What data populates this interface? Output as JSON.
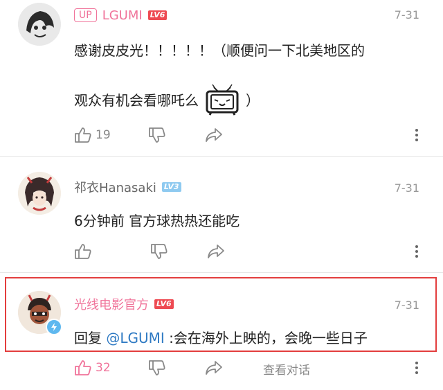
{
  "comments": [
    {
      "up_badge": "UP",
      "username": "LGUMI",
      "level": "LV6",
      "date": "7-31",
      "text_line1": "感谢皮皮光！！！！！（顺便问一下北美地区的",
      "text_line2_before": "观众有机会看哪吒么",
      "text_line2_after": "）",
      "emote_icon": "bilibili-tv-emote-icon",
      "likes": "19"
    },
    {
      "username": "祁衣Hanasaki",
      "level": "LV3",
      "date": "7-31",
      "text": "6分钟前 官方球热热还能吃"
    },
    {
      "username": "光线电影官方",
      "level": "LV6",
      "date": "7-31",
      "text_prefix": "回复 ",
      "mention": "@LGUMI",
      "text_suffix": " :会在海外上映的，会晚一些日子",
      "likes": "32",
      "view_replies": "查看对话"
    }
  ],
  "colors": {
    "accent_pink": "#f0739a",
    "level_red": "#ee4a52",
    "level_blue": "#8fcaf0",
    "mention_blue": "#2f7ac3",
    "highlight_red": "#e33d3d"
  },
  "icons": [
    "thumbs-up-icon",
    "thumbs-down-icon",
    "share-arrow-icon",
    "more-vertical-icon",
    "verified-bolt-icon"
  ]
}
